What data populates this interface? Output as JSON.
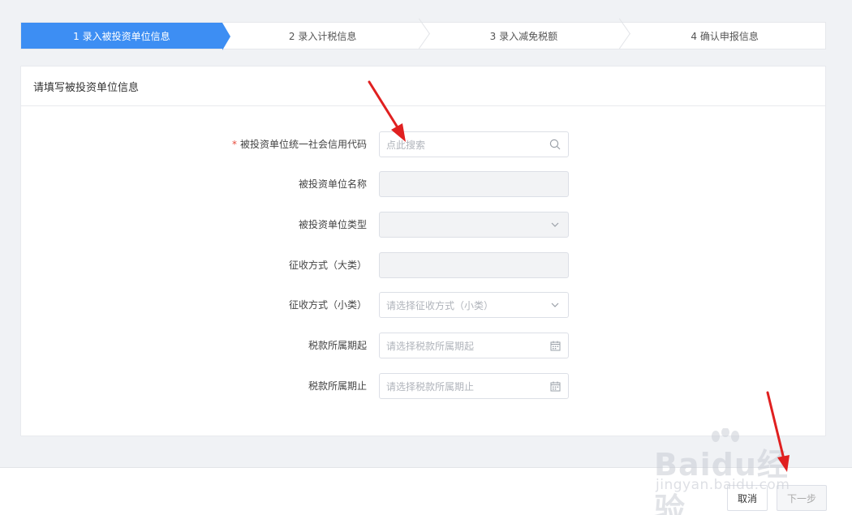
{
  "steps": [
    {
      "label": "1 录入被投资单位信息",
      "active": true
    },
    {
      "label": "2 录入计税信息",
      "active": false
    },
    {
      "label": "3 录入减免税额",
      "active": false
    },
    {
      "label": "4 确认申报信息",
      "active": false
    }
  ],
  "form": {
    "title": "请填写被投资单位信息",
    "fields": [
      {
        "label": "被投资单位统一社会信用代码",
        "required": true,
        "placeholder": "点此搜索",
        "icon": "search-icon",
        "disabled": false
      },
      {
        "label": "被投资单位名称",
        "required": false,
        "placeholder": "",
        "icon": "",
        "disabled": true
      },
      {
        "label": "被投资单位类型",
        "required": false,
        "placeholder": "",
        "icon": "chevron-down-icon",
        "disabled": true
      },
      {
        "label": "征收方式（大类）",
        "required": false,
        "placeholder": "",
        "icon": "",
        "disabled": true
      },
      {
        "label": "征收方式（小类）",
        "required": false,
        "placeholder": "请选择征收方式（小类）",
        "icon": "chevron-down-icon",
        "disabled": false
      },
      {
        "label": "税款所属期起",
        "required": false,
        "placeholder": "请选择税款所属期起",
        "icon": "calendar-icon",
        "disabled": false
      },
      {
        "label": "税款所属期止",
        "required": false,
        "placeholder": "请选择税款所属期止",
        "icon": "calendar-icon",
        "disabled": false
      }
    ]
  },
  "footer": {
    "cancel_label": "取消",
    "next_label": "下一步"
  },
  "watermark": {
    "brand": "Baidu经验",
    "url": "jingyan.baidu.com"
  },
  "colors": {
    "accent": "#3d8ef3",
    "required": "#e74c3c",
    "annotation_arrow": "#e02020"
  }
}
